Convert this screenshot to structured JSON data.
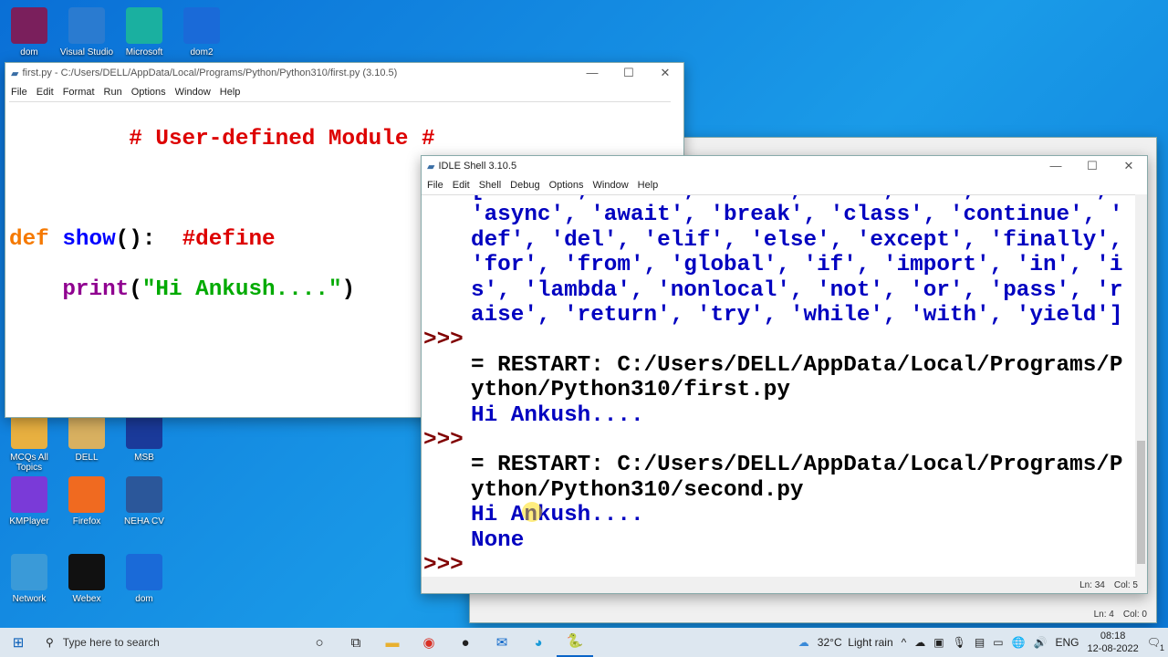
{
  "desktop_icons": [
    {
      "label": "dom",
      "color": "#7a1f5c"
    },
    {
      "label": "Visual Studio",
      "color": "#2a7bd0"
    },
    {
      "label": "Microsoft",
      "color": "#1ab0a0"
    },
    {
      "label": "dom2",
      "color": "#1a6ad8"
    },
    {
      "label": "MCQs All Topics",
      "color": "#e8b040"
    },
    {
      "label": "DELL",
      "color": "#d8b060"
    },
    {
      "label": "MSB",
      "color": "#1a3a9a"
    },
    {
      "label": "KMPlayer",
      "color": "#7a3ad8"
    },
    {
      "label": "Firefox",
      "color": "#f06a20"
    },
    {
      "label": "NEHA CV",
      "color": "#2b579a"
    },
    {
      "label": "Network",
      "color": "#3a9ad8"
    },
    {
      "label": "Webex",
      "color": "#111"
    },
    {
      "label": "dom",
      "color": "#1a6ad8"
    }
  ],
  "editor": {
    "title": "first.py - C:/Users/DELL/AppData/Local/Programs/Python/Python310/first.py (3.10.5)",
    "menu": [
      "File",
      "Edit",
      "Format",
      "Run",
      "Options",
      "Window",
      "Help"
    ],
    "line1": "         # User-defined Module #",
    "line3_kw": "def ",
    "line3_fn": "show",
    "line3_rest": "():  ",
    "line3_cm": "#define",
    "line4_indent": "    ",
    "line4_bi": "print",
    "line4_p1": "(",
    "line4_str": "\"Hi Ankush....\"",
    "line4_p2": ")"
  },
  "back_editor": {
    "status_ln": "Ln: 4",
    "status_col": "Col: 0"
  },
  "shell": {
    "title": "IDLE Shell 3.10.5",
    "menu": [
      "File",
      "Edit",
      "Shell",
      "Debug",
      "Options",
      "Window",
      "Help"
    ],
    "lines": [
      {
        "prompt": "",
        "text": "['False', 'None', 'True', 'and', 'as', 'assert', ",
        "cls": "out"
      },
      {
        "prompt": "",
        "text": "'async', 'await', 'break', 'class', 'continue', '",
        "cls": "out"
      },
      {
        "prompt": "",
        "text": "def', 'del', 'elif', 'else', 'except', 'finally',",
        "cls": "out"
      },
      {
        "prompt": "",
        "text": "'for', 'from', 'global', 'if', 'import', 'in', 'i",
        "cls": "out"
      },
      {
        "prompt": "",
        "text": "s', 'lambda', 'nonlocal', 'not', 'or', 'pass', 'r",
        "cls": "out"
      },
      {
        "prompt": "",
        "text": "aise', 'return', 'try', 'while', 'with', 'yield']",
        "cls": "out"
      },
      {
        "prompt": ">>>",
        "text": "",
        "cls": "out"
      },
      {
        "prompt": "",
        "text": "= RESTART: C:/Users/DELL/AppData/Local/Programs/P",
        "cls": "plain"
      },
      {
        "prompt": "",
        "text": "ython/Python310/first.py",
        "cls": "plain"
      },
      {
        "prompt": "",
        "text": "Hi Ankush....",
        "cls": "out"
      },
      {
        "prompt": ">>>",
        "text": "",
        "cls": "out"
      },
      {
        "prompt": "",
        "text": "= RESTART: C:/Users/DELL/AppData/Local/Programs/P",
        "cls": "plain"
      },
      {
        "prompt": "",
        "text": "ython/Python310/second.py",
        "cls": "plain"
      },
      {
        "prompt": "",
        "text": "Hi Ankush....",
        "cls": "out"
      },
      {
        "prompt": "",
        "text": "None",
        "cls": "out"
      },
      {
        "prompt": ">>>",
        "text": "",
        "cls": "out"
      }
    ],
    "status_ln": "Ln: 34",
    "status_col": "Col: 5"
  },
  "taskbar": {
    "search_placeholder": "Type here to search",
    "weather": "32°C  Light rain",
    "lang": "ENG",
    "time": "08:18",
    "date": "12-08-2022",
    "notif_count": "1"
  }
}
